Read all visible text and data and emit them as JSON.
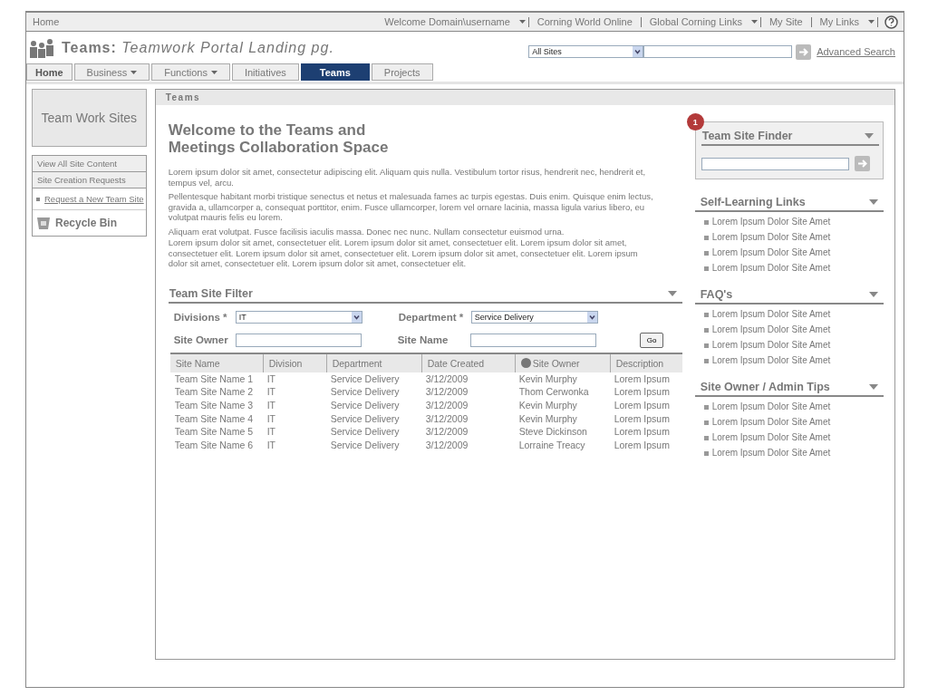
{
  "top_bar": {
    "home": "Home",
    "links": [
      {
        "label": "Welcome Domain\\username",
        "has_caret": true
      },
      {
        "label": "Corning World Online",
        "has_caret": false
      },
      {
        "label": "Global Corning Links",
        "has_caret": true
      },
      {
        "label": "My Site",
        "has_caret": false
      },
      {
        "label": "My Links",
        "has_caret": true
      }
    ]
  },
  "header": {
    "title_bold": "Teams:",
    "title_italic": "Teamwork Portal Landing pg.",
    "scope": "All Sites",
    "advanced_search": "Advanced Search"
  },
  "tabs": [
    {
      "label": "Home",
      "has_caret": false,
      "selected": false,
      "kind": "home"
    },
    {
      "label": "Business",
      "has_caret": true,
      "selected": false,
      "kind": "tab"
    },
    {
      "label": "Functions",
      "has_caret": true,
      "selected": false,
      "kind": "tab"
    },
    {
      "label": "Initiatives",
      "has_caret": false,
      "selected": false,
      "kind": "tab"
    },
    {
      "label": "Teams",
      "has_caret": false,
      "selected": true,
      "kind": "tab"
    },
    {
      "label": "Projects",
      "has_caret": false,
      "selected": false,
      "kind": "tab"
    }
  ],
  "sidebar": {
    "title": "Team Work Sites",
    "items": [
      "View All Site Content",
      "Site Creation Requests"
    ],
    "link": "Request a New Team Site",
    "recycle_bin": "Recycle Bin"
  },
  "panel": {
    "title": "Teams",
    "heading": "Welcome to the Teams and Meetings Collaboration Space",
    "paragraphs": [
      "Lorem ipsum dolor sit amet, consectetur adipiscing elit. Aliquam quis nulla. Vestibulum tortor risus, hendrerit nec, hendrerit et, tempus vel, arcu.",
      "Pellentesque habitant morbi tristique senectus et netus et malesuada fames ac turpis egestas. Duis enim. Quisque enim lectus, gravida a, ullamcorper a, consequat porttitor, enim. Fusce ullamcorper, lorem vel ornare lacinia, massa ligula varius libero, eu volutpat mauris felis eu lorem.",
      "Aliquam erat volutpat. Fusce facilisis iaculis massa. Donec nec nunc. Nullam consectetur euismod urna.",
      "Lorem ipsum dolor sit amet, consectetuer elit. Lorem ipsum dolor sit amet, consectetuer elit.  Lorem ipsum dolor sit amet, consectetuer elit. Lorem ipsum dolor sit amet, consectetuer elit. Lorem ipsum dolor sit amet, consectetuer elit. Lorem ipsum dolor sit amet, consectetuer elit.  Lorem ipsum dolor sit amet, consectetuer elit."
    ]
  },
  "filter": {
    "title": "Team Site Filter",
    "divisions_label": "Divisions *",
    "divisions_value": "IT",
    "department_label": "Department *",
    "department_value": "Service Delivery",
    "owner_label": "Site Owner",
    "name_label": "Site Name",
    "go": "Go"
  },
  "table": {
    "columns": [
      "Site Name",
      "Division",
      "Department",
      "Date Created",
      "Site Owner",
      "Description"
    ],
    "rows": [
      [
        "Team Site Name 1",
        "IT",
        "Service Delivery",
        "3/12/2009",
        "Kevin Murphy",
        "Lorem Ipsum"
      ],
      [
        "Team Site Name 2",
        "IT",
        "Service Delivery",
        "3/12/2009",
        "Thom Cerwonka",
        "Lorem Ipsum"
      ],
      [
        "Team Site Name 3",
        "IT",
        "Service Delivery",
        "3/12/2009",
        "Kevin Murphy",
        "Lorem Ipsum"
      ],
      [
        "Team Site Name 4",
        "IT",
        "Service Delivery",
        "3/12/2009",
        "Kevin Murphy",
        "Lorem Ipsum"
      ],
      [
        "Team Site Name 5",
        "IT",
        "Service Delivery",
        "3/12/2009",
        "Steve Dickinson",
        "Lorem Ipsum"
      ],
      [
        "Team Site Name 6",
        "IT",
        "Service Delivery",
        "3/12/2009",
        "Lorraine Treacy",
        "Lorem Ipsum"
      ]
    ]
  },
  "finder": {
    "badge": "1",
    "title": "Team Site Finder"
  },
  "link_sections": [
    {
      "title": "Self-Learning Links",
      "items": [
        "Lorem Ipsum Dolor Site Amet",
        "Lorem Ipsum Dolor Site Amet",
        "Lorem Ipsum Dolor Site Amet",
        "Lorem Ipsum Dolor Site Amet"
      ]
    },
    {
      "title": "FAQ's",
      "items": [
        "Lorem Ipsum Dolor Site Amet",
        "Lorem Ipsum Dolor Site Amet",
        "Lorem Ipsum Dolor Site Amet",
        "Lorem Ipsum Dolor Site Amet"
      ]
    },
    {
      "title": "Site Owner / Admin Tips",
      "items": [
        "Lorem Ipsum Dolor Site Amet",
        "Lorem Ipsum Dolor Site Amet",
        "Lorem Ipsum Dolor Site Amet",
        "Lorem Ipsum Dolor Site Amet"
      ]
    }
  ]
}
